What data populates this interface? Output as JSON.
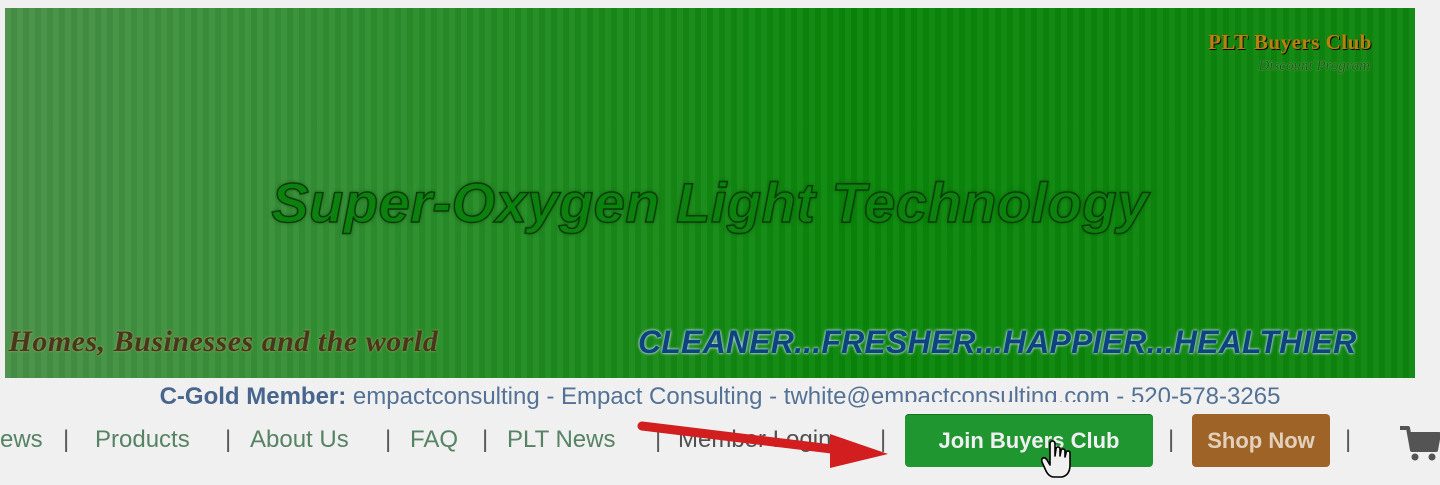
{
  "banner": {
    "club_title": "PLT Buyers Club",
    "club_subtitle": "Discount Program",
    "headline": "Super-Oxygen Light Technology",
    "tagline_left": "g Homes, Businesses and the world",
    "tagline_right": "CLEANER...FRESHER...HAPPIER...HEALTHIER"
  },
  "member": {
    "label": "C-Gold Member:",
    "info": " empactconsulting - Empact Consulting - twhite@empactconsulting.com - 520-578-3265"
  },
  "nav": {
    "items": [
      "ews",
      "Products",
      "About Us",
      "FAQ",
      "PLT News",
      "Member Login"
    ],
    "separator": "|",
    "join_label": "Join Buyers Club",
    "shop_label": "Shop Now"
  },
  "colors": {
    "banner_green": "#0b900b",
    "join_button": "#22a035",
    "shop_button": "#a86a2a",
    "arrow_red": "#e02020"
  },
  "icons": [
    "cart-icon",
    "pointer-hand-icon",
    "red-arrow-icon"
  ]
}
